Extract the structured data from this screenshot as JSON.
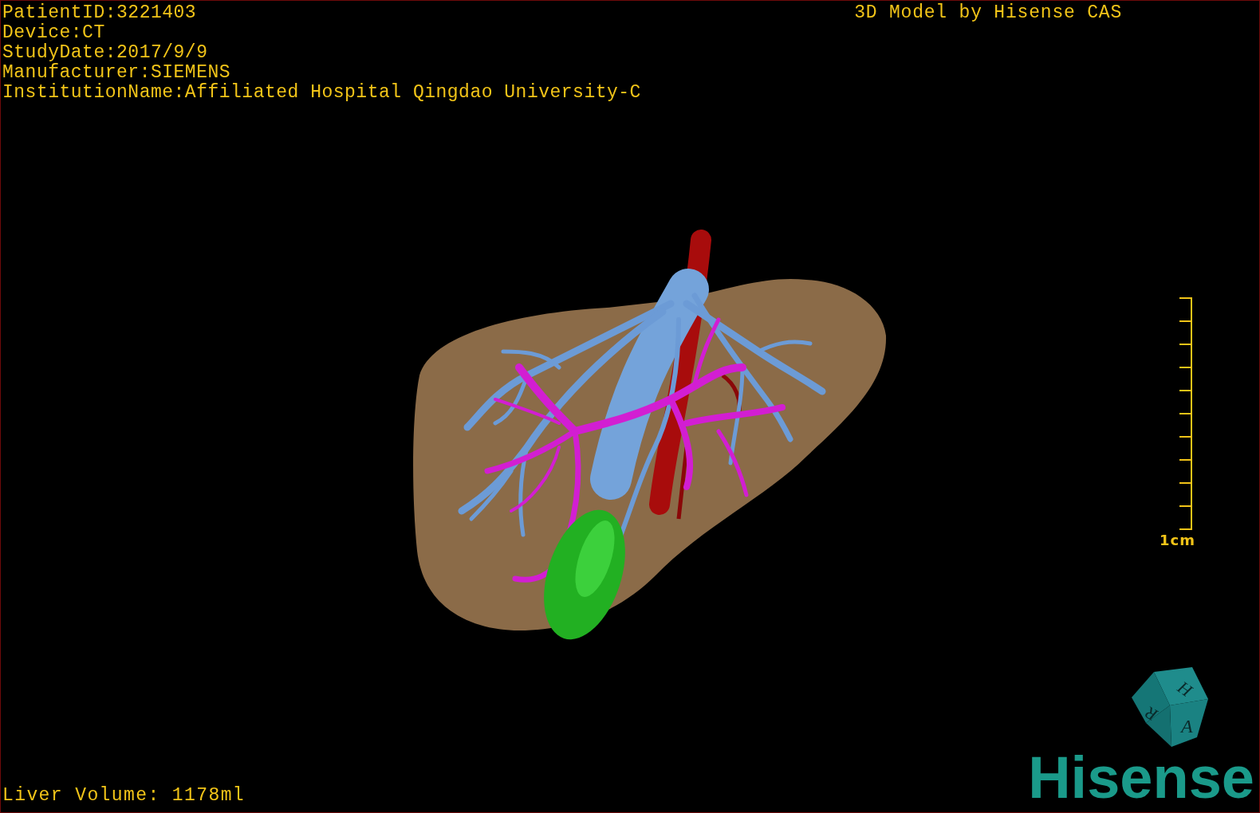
{
  "patient_info": [
    "PatientID:3221403",
    "Device:CT",
    "StudyDate:2017/9/9",
    "Manufacturer:SIEMENS",
    "InstitutionName:Affiliated Hospital Qingdao University-C"
  ],
  "title": "3D Model by Hisense CAS",
  "scale_bar": {
    "label": "1cm"
  },
  "orientation_cube": {
    "labels": [
      "H",
      "R",
      "A"
    ]
  },
  "logo": {
    "text": "Hisense"
  },
  "liver_volume": "Liver Volume: 1178ml"
}
